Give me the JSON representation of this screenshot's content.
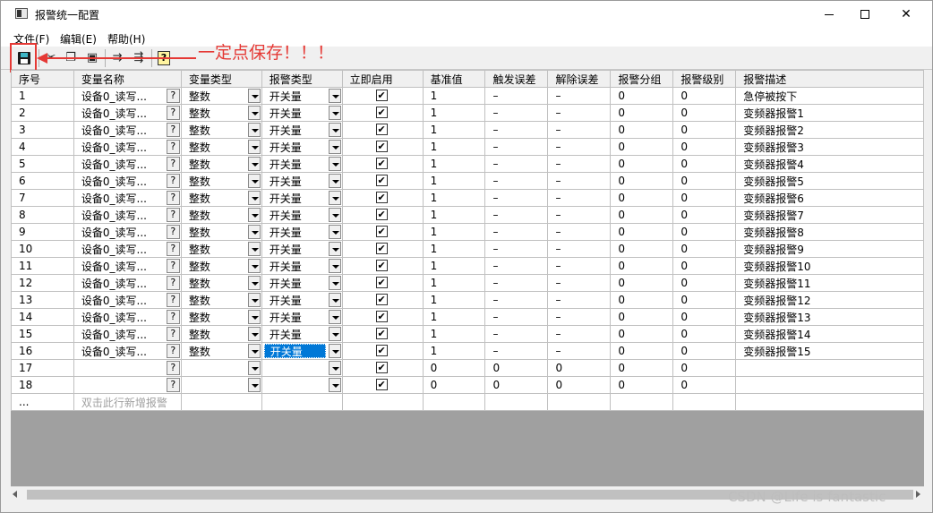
{
  "window": {
    "title": "报警统一配置",
    "controls": {
      "minimize": "min",
      "maximize": "max",
      "close": "✕"
    }
  },
  "menu": {
    "items": [
      "文件(F)",
      "编辑(E)",
      "帮助(H)"
    ]
  },
  "toolbar": {
    "buttons": [
      "save-icon",
      "cut-icon",
      "copy-icon",
      "paste-icon",
      "insert-row-icon",
      "delete-row-icon",
      "help-icon"
    ]
  },
  "annotation": {
    "text": "一定点保存！！！",
    "color": "#e53935"
  },
  "grid": {
    "headers": [
      "序号",
      "变量名称",
      "变量类型",
      "报警类型",
      "立即启用",
      "基准值",
      "触发误差",
      "解除误差",
      "报警分组",
      "报警级别",
      "报警描述"
    ],
    "rows": [
      [
        "1",
        "设备0_读写...",
        "整数",
        "开关量",
        true,
        "1",
        "–",
        "–",
        "0",
        "0",
        "急停被按下"
      ],
      [
        "2",
        "设备0_读写...",
        "整数",
        "开关量",
        true,
        "1",
        "–",
        "–",
        "0",
        "0",
        "变频器报警1"
      ],
      [
        "3",
        "设备0_读写...",
        "整数",
        "开关量",
        true,
        "1",
        "–",
        "–",
        "0",
        "0",
        "变频器报警2"
      ],
      [
        "4",
        "设备0_读写...",
        "整数",
        "开关量",
        true,
        "1",
        "–",
        "–",
        "0",
        "0",
        "变频器报警3"
      ],
      [
        "5",
        "设备0_读写...",
        "整数",
        "开关量",
        true,
        "1",
        "–",
        "–",
        "0",
        "0",
        "变频器报警4"
      ],
      [
        "6",
        "设备0_读写...",
        "整数",
        "开关量",
        true,
        "1",
        "–",
        "–",
        "0",
        "0",
        "变频器报警5"
      ],
      [
        "7",
        "设备0_读写...",
        "整数",
        "开关量",
        true,
        "1",
        "–",
        "–",
        "0",
        "0",
        "变频器报警6"
      ],
      [
        "8",
        "设备0_读写...",
        "整数",
        "开关量",
        true,
        "1",
        "–",
        "–",
        "0",
        "0",
        "变频器报警7"
      ],
      [
        "9",
        "设备0_读写...",
        "整数",
        "开关量",
        true,
        "1",
        "–",
        "–",
        "0",
        "0",
        "变频器报警8"
      ],
      [
        "10",
        "设备0_读写...",
        "整数",
        "开关量",
        true,
        "1",
        "–",
        "–",
        "0",
        "0",
        "变频器报警9"
      ],
      [
        "11",
        "设备0_读写...",
        "整数",
        "开关量",
        true,
        "1",
        "–",
        "–",
        "0",
        "0",
        "变频器报警10"
      ],
      [
        "12",
        "设备0_读写...",
        "整数",
        "开关量",
        true,
        "1",
        "–",
        "–",
        "0",
        "0",
        "变频器报警11"
      ],
      [
        "13",
        "设备0_读写...",
        "整数",
        "开关量",
        true,
        "1",
        "–",
        "–",
        "0",
        "0",
        "变频器报警12"
      ],
      [
        "14",
        "设备0_读写...",
        "整数",
        "开关量",
        true,
        "1",
        "–",
        "–",
        "0",
        "0",
        "变频器报警13"
      ],
      [
        "15",
        "设备0_读写...",
        "整数",
        "开关量",
        true,
        "1",
        "–",
        "–",
        "0",
        "0",
        "变频器报警14"
      ],
      [
        "16",
        "设备0_读写...",
        "整数",
        "开关量",
        true,
        "1",
        "–",
        "–",
        "0",
        "0",
        "变频器报警15"
      ],
      [
        "17",
        "",
        "",
        "",
        true,
        "0",
        "0",
        "0",
        "0",
        "0",
        ""
      ],
      [
        "18",
        "",
        "",
        "",
        true,
        "0",
        "0",
        "0",
        "0",
        "0",
        ""
      ]
    ],
    "selected_row": 16,
    "new_row": {
      "seq": "...",
      "hint": "双击此行新增报警"
    },
    "selection_color": "#0078d7"
  },
  "watermark": "CSDN @Life is fantastic"
}
